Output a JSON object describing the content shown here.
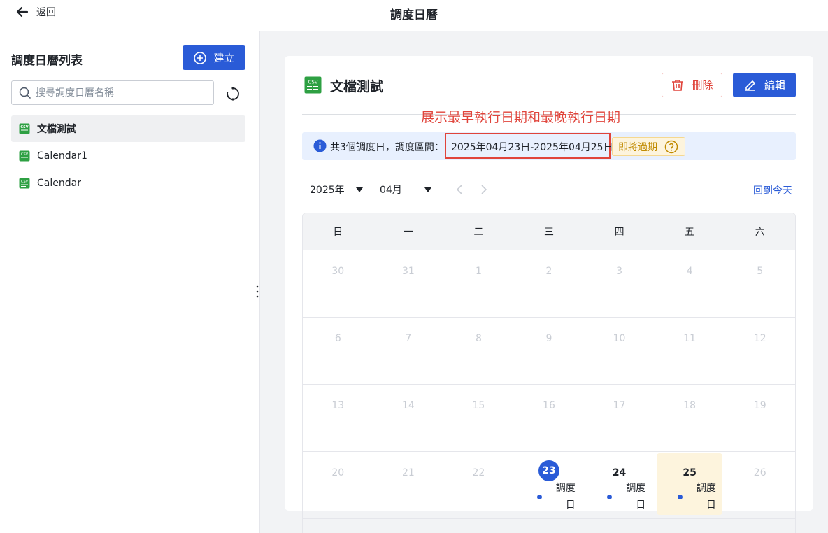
{
  "header": {
    "back_label": "返回",
    "title": "調度日曆"
  },
  "sidebar": {
    "title": "調度日曆列表",
    "create_label": "建立",
    "search_placeholder": "搜尋調度日曆名稱",
    "items": [
      {
        "label": "文檔測試",
        "active": true
      },
      {
        "label": "Calendar1",
        "active": false
      },
      {
        "label": "Calendar",
        "active": false
      }
    ]
  },
  "detail": {
    "title": "文檔測試",
    "delete_label": "刪除",
    "edit_label": "編輯",
    "annotation": "展示最早執行日期和最晚執行日期",
    "info_prefix": "共3個調度日，調度區間：",
    "info_range": "2025年04月23日-2025年04月25日",
    "expire_label": "即將過期",
    "year_value": "2025年",
    "month_value": "04月",
    "today_label": "回到今天"
  },
  "calendar": {
    "weekdays": [
      "日",
      "一",
      "二",
      "三",
      "四",
      "五",
      "六"
    ],
    "weeks": [
      [
        "30",
        "31",
        "1",
        "2",
        "3",
        "4",
        "5"
      ],
      [
        "6",
        "7",
        "8",
        "9",
        "10",
        "11",
        "12"
      ],
      [
        "13",
        "14",
        "15",
        "16",
        "17",
        "18",
        "19"
      ],
      [
        "20",
        "21",
        "22",
        "23",
        "24",
        "25",
        "26"
      ]
    ],
    "event_label": "調度日",
    "scheduled_days": [
      "23",
      "24",
      "25"
    ],
    "today": "23",
    "highlighted": "25"
  },
  "colors": {
    "primary": "#2a5bd7",
    "danger": "#e0443b",
    "warning_bg": "#fdf4dd",
    "warning_text": "#c08a00",
    "info_bg": "#e8f0fe"
  },
  "icons": [
    "arrow-left-icon",
    "plus-circle-icon",
    "search-icon",
    "refresh-icon",
    "csv-file-icon",
    "trash-icon",
    "edit-icon",
    "info-icon",
    "question-icon",
    "chevron-left-icon",
    "chevron-right-icon",
    "drag-handle-icon"
  ]
}
